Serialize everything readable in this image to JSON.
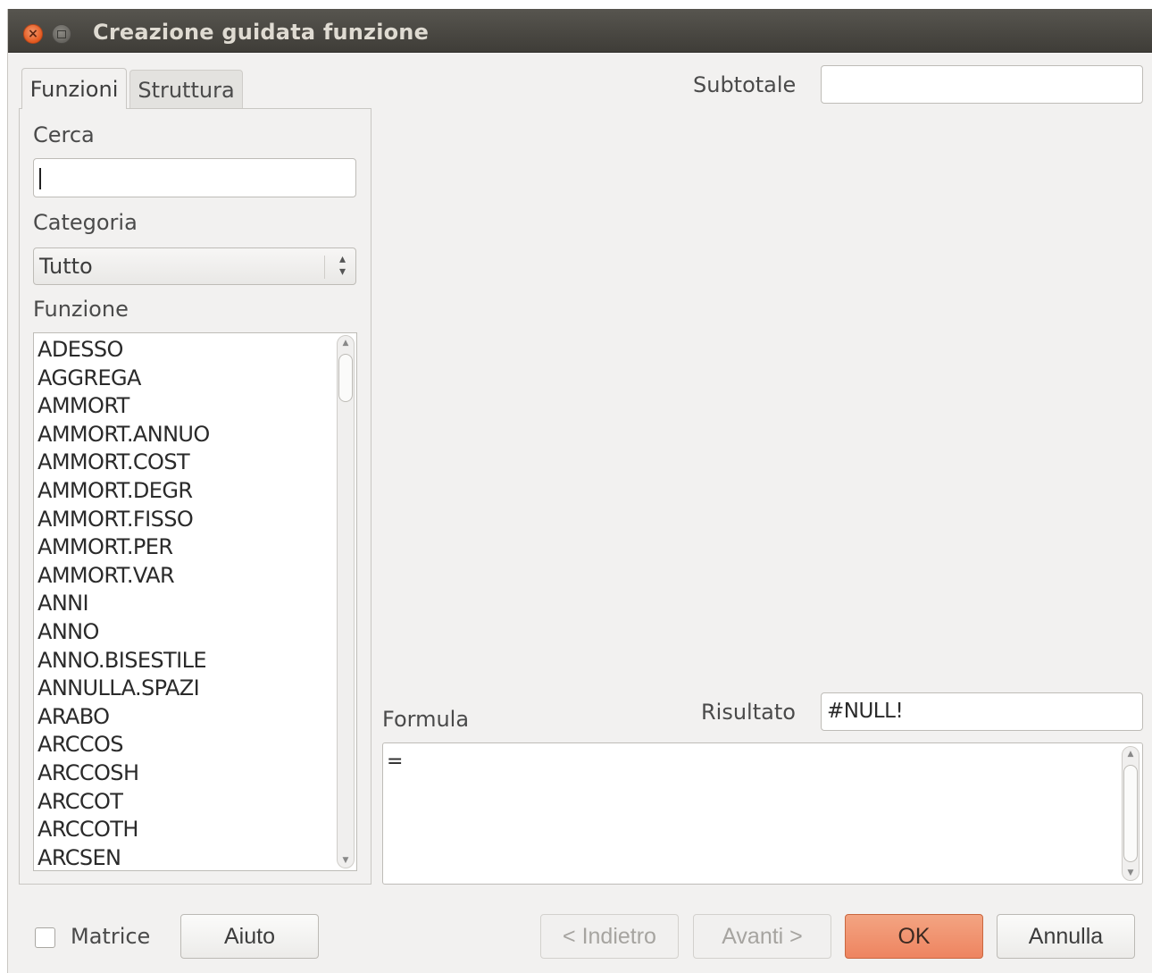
{
  "window": {
    "title": "Creazione guidata funzione",
    "close_glyph": "×"
  },
  "tabs": [
    {
      "label": "Funzioni",
      "active": true
    },
    {
      "label": "Struttura",
      "active": false
    }
  ],
  "search": {
    "label": "Cerca",
    "value": ""
  },
  "category": {
    "label": "Categoria",
    "selected": "Tutto"
  },
  "function_list": {
    "label": "Funzione",
    "items": [
      "ADESSO",
      "AGGREGA",
      "AMMORT",
      "AMMORT.ANNUO",
      "AMMORT.COST",
      "AMMORT.DEGR",
      "AMMORT.FISSO",
      "AMMORT.PER",
      "AMMORT.VAR",
      "ANNI",
      "ANNO",
      "ANNO.BISESTILE",
      "ANNULLA.SPAZI",
      "ARABO",
      "ARCCOS",
      "ARCCOSH",
      "ARCCOT",
      "ARCCOTH",
      "ARCSEN"
    ]
  },
  "subtotal": {
    "label": "Subtotale",
    "value": ""
  },
  "result": {
    "label": "Risultato",
    "value": "#NULL!"
  },
  "formula": {
    "label": "Formula",
    "value": "="
  },
  "footer": {
    "matrix_label": "Matrice",
    "matrix_checked": false,
    "help": "Aiuto",
    "back": "< Indietro",
    "next": "Avanti >",
    "ok": "OK",
    "cancel": "Annulla"
  },
  "colors": {
    "ok_button": "#ee8a66",
    "titlebar": "#4b4943",
    "close_button": "#e65a1f"
  }
}
